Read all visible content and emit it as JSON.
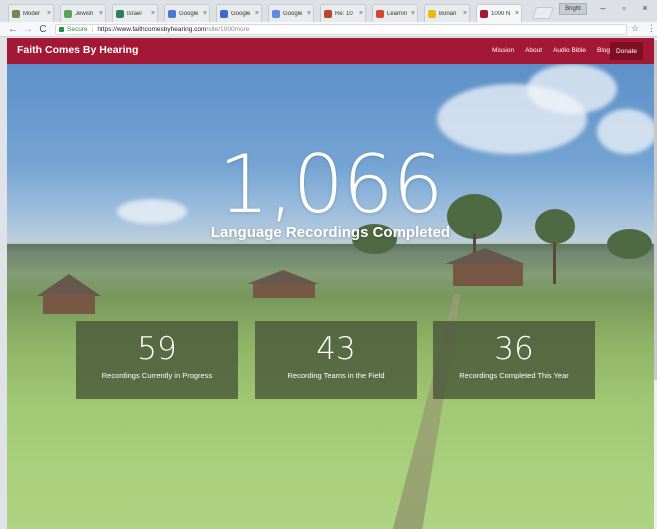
{
  "browser": {
    "tabs": [
      {
        "label": "Moder",
        "color": "#6b8e4e"
      },
      {
        "label": "Jewish",
        "color": "#5ba05b"
      },
      {
        "label": "Israel",
        "color": "#2e7d5b"
      },
      {
        "label": "Google",
        "color": "#4a7bd1"
      },
      {
        "label": "Google",
        "color": "#3b6cc9"
      },
      {
        "label": "Google",
        "color": "#5f8be0"
      },
      {
        "label": "Re: 10",
        "color": "#b5492f"
      },
      {
        "label": "Learnin",
        "color": "#d44638"
      },
      {
        "label": "Bonan",
        "color": "#f2b90c"
      },
      {
        "label": "1000 N",
        "color": "#a31834",
        "active": true
      }
    ],
    "tab_close_glyph": "×",
    "profile_label": "Bright",
    "window_controls": {
      "minimize": "–",
      "maximize": "▫",
      "close": "×"
    },
    "nav": {
      "back": "←",
      "forward": "→",
      "reload": "C"
    },
    "address": {
      "secure_label": "Secure",
      "separator": "|",
      "host": "https://www.faithcomesbyhearing.com",
      "path": "/site/1000more"
    },
    "star_glyph": "☆",
    "menu_glyph": "⋮"
  },
  "site": {
    "brand": "Faith Comes By Hearing",
    "nav_items": [
      "Mission",
      "About",
      "Audio Bible",
      "Blog"
    ],
    "donate_label": "Donate",
    "brand_color": "#a31834"
  },
  "hero": {
    "big_number": "1,066",
    "caption": "Language Recordings Completed",
    "stats": [
      {
        "value": "59",
        "label": "Recordings Currently in Progress"
      },
      {
        "value": "43",
        "label": "Recording Teams in the Field"
      },
      {
        "value": "36",
        "label": "Recordings Completed This Year"
      }
    ]
  }
}
